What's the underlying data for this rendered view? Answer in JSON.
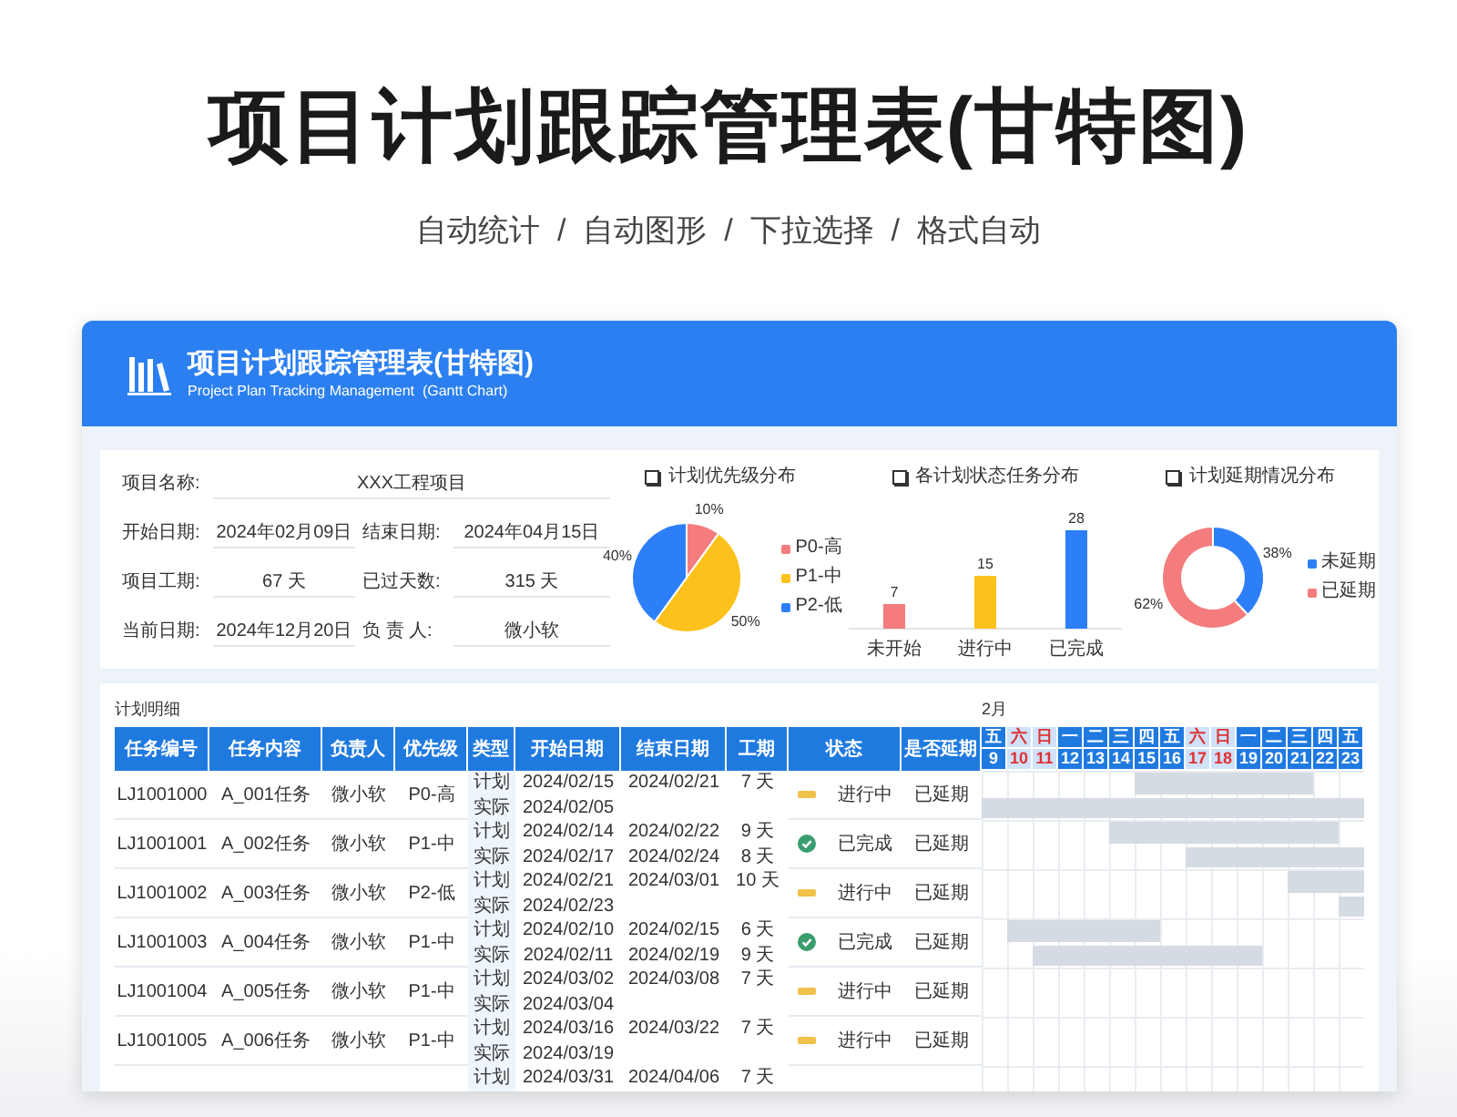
{
  "page_title": "项目计划跟踪管理表(甘特图)",
  "page_subtitle": "自动统计  /  自动图形  /  下拉选择  /  格式自动",
  "header": {
    "title": "项目计划跟踪管理表(甘特图)",
    "subtitle": "Project Plan Tracking Management  (Gantt Chart)"
  },
  "info": {
    "project_name": {
      "label": "项目名称:",
      "value": "XXX工程项目"
    },
    "start_date": {
      "label": "开始日期:",
      "value": "2024年02月09日"
    },
    "end_date": {
      "label": "结束日期:",
      "value": "2024年04月15日"
    },
    "duration": {
      "label": "项目工期:",
      "value": "67 天"
    },
    "elapsed": {
      "label": "已过天数:",
      "value": "315 天"
    },
    "current_date": {
      "label": "当前日期:",
      "value": "2024年12月20日"
    },
    "owner": {
      "label": "负 责 人:",
      "value": "微小软"
    }
  },
  "charts": [
    {
      "chart_data": {
        "type": "pie",
        "title": "计划优先级分布",
        "categories": [
          "P0-高",
          "P1-中",
          "P2-低"
        ],
        "values": [
          10,
          50,
          40
        ],
        "colors": [
          "#f47c7c",
          "#fcc21b",
          "#2d7ff9"
        ],
        "data_labels": true,
        "value_labels": [
          "10%",
          "50%",
          "40%"
        ]
      }
    },
    {
      "chart_data": {
        "type": "bar",
        "title": "各计划状态任务分布",
        "categories": [
          "未开始",
          "进行中",
          "已完成"
        ],
        "values": [
          7,
          15,
          28
        ],
        "colors": [
          "#f47c7c",
          "#fcc21b",
          "#2d7ff9"
        ],
        "data_labels": true
      }
    },
    {
      "chart_data": {
        "type": "donut",
        "title": "计划延期情况分布",
        "categories": [
          "未延期",
          "已延期"
        ],
        "values": [
          38,
          62
        ],
        "colors": [
          "#2d7ff9",
          "#f47c7c"
        ],
        "data_labels": true,
        "value_labels": [
          "38%",
          "62%"
        ]
      }
    }
  ],
  "table": {
    "caption": "计划明细",
    "columns": [
      "任务编号",
      "任务内容",
      "负责人",
      "优先级",
      "类型",
      "开始日期",
      "结束日期",
      "工期",
      "状态",
      "是否延期"
    ],
    "gantt": {
      "month": "2月",
      "days": [
        {
          "weekday": "五",
          "date": "9",
          "weekend": false
        },
        {
          "weekday": "六",
          "date": "10",
          "weekend": true
        },
        {
          "weekday": "日",
          "date": "11",
          "weekend": true
        },
        {
          "weekday": "一",
          "date": "12",
          "weekend": false
        },
        {
          "weekday": "二",
          "date": "13",
          "weekend": false
        },
        {
          "weekday": "三",
          "date": "14",
          "weekend": false
        },
        {
          "weekday": "四",
          "date": "15",
          "weekend": false
        },
        {
          "weekday": "五",
          "date": "16",
          "weekend": false
        },
        {
          "weekday": "六",
          "date": "17",
          "weekend": true
        },
        {
          "weekday": "日",
          "date": "18",
          "weekend": true
        },
        {
          "weekday": "一",
          "date": "19",
          "weekend": false
        },
        {
          "weekday": "二",
          "date": "20",
          "weekend": false
        },
        {
          "weekday": "三",
          "date": "21",
          "weekend": false
        },
        {
          "weekday": "四",
          "date": "22",
          "weekend": false
        },
        {
          "weekday": "五",
          "date": "23",
          "weekend": false
        }
      ]
    },
    "rows": [
      {
        "id": "LJ1001000",
        "content": "A_001任务",
        "owner": "微小软",
        "priority": "P0-高",
        "plan": {
          "type": "计划",
          "start": "2024/02/15",
          "end": "2024/02/21",
          "duration": "7 天"
        },
        "actual": {
          "type": "实际",
          "start": "2024/02/05"
        },
        "status": {
          "kind": "in_progress",
          "label": "进行中"
        },
        "delay": "已延期"
      },
      {
        "id": "LJ1001001",
        "content": "A_002任务",
        "owner": "微小软",
        "priority": "P1-中",
        "plan": {
          "type": "计划",
          "start": "2024/02/14",
          "end": "2024/02/22",
          "duration": "9 天"
        },
        "actual": {
          "type": "实际",
          "start": "2024/02/17",
          "end": "2024/02/24",
          "duration": "8 天"
        },
        "status": {
          "kind": "done",
          "label": "已完成"
        },
        "delay": "已延期"
      },
      {
        "id": "LJ1001002",
        "content": "A_003任务",
        "owner": "微小软",
        "priority": "P2-低",
        "plan": {
          "type": "计划",
          "start": "2024/02/21",
          "end": "2024/03/01",
          "duration": "10 天"
        },
        "actual": {
          "type": "实际",
          "start": "2024/02/23"
        },
        "status": {
          "kind": "in_progress",
          "label": "进行中"
        },
        "delay": "已延期"
      },
      {
        "id": "LJ1001003",
        "content": "A_004任务",
        "owner": "微小软",
        "priority": "P1-中",
        "plan": {
          "type": "计划",
          "start": "2024/02/10",
          "end": "2024/02/15",
          "duration": "6 天"
        },
        "actual": {
          "type": "实际",
          "start": "2024/02/11",
          "end": "2024/02/19",
          "duration": "9 天"
        },
        "status": {
          "kind": "done",
          "label": "已完成"
        },
        "delay": "已延期"
      },
      {
        "id": "LJ1001004",
        "content": "A_005任务",
        "owner": "微小软",
        "priority": "P1-中",
        "plan": {
          "type": "计划",
          "start": "2024/03/02",
          "end": "2024/03/08",
          "duration": "7 天"
        },
        "actual": {
          "type": "实际",
          "start": "2024/03/04"
        },
        "status": {
          "kind": "in_progress",
          "label": "进行中"
        },
        "delay": "已延期"
      },
      {
        "id": "LJ1001005",
        "content": "A_006任务",
        "owner": "微小软",
        "priority": "P1-中",
        "plan": {
          "type": "计划",
          "start": "2024/03/16",
          "end": "2024/03/22",
          "duration": "7 天"
        },
        "actual": {
          "type": "实际",
          "start": "2024/03/19"
        },
        "status": {
          "kind": "in_progress",
          "label": "进行中"
        },
        "delay": "已延期"
      },
      {
        "plan": {
          "type": "计划",
          "start": "2024/03/31",
          "end": "2024/04/06",
          "duration": "7 天"
        }
      }
    ]
  }
}
